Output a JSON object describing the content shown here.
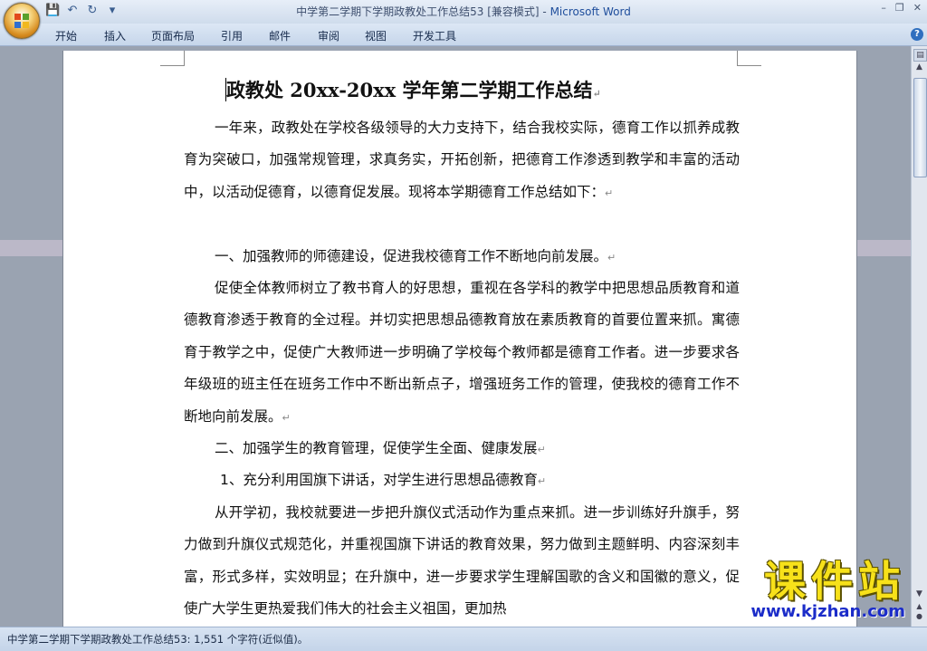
{
  "window": {
    "title_doc": "中学第二学期下学期政教处工作总结53 [兼容模式]",
    "title_sep": " - ",
    "title_app": "Microsoft Word",
    "min": "–",
    "restore": "❐",
    "close": "✕"
  },
  "qat": {
    "save_icon": "floppy-disk-icon",
    "undo_icon": "undo-icon",
    "redo_icon": "redo-icon",
    "customize_icon": "dropdown-icon"
  },
  "ribbon_tabs": [
    "开始",
    "插入",
    "页面布局",
    "引用",
    "邮件",
    "审阅",
    "视图",
    "开发工具"
  ],
  "document": {
    "title": "政教处 20xx-20xx 学年第二学期工作总结",
    "paragraphs": [
      "一年来，政教处在学校各级领导的大力支持下，结合我校实际，德育工作以抓养成教育为突破口，加强常规管理，求真务实，开拓创新，把德育工作渗透到教学和丰富的活动中，以活动促德育，以德育促发展。现将本学期德育工作总结如下：",
      "一、加强教师的师德建设，促进我校德育工作不断地向前发展。",
      "促使全体教师树立了教书育人的好思想，重视在各学科的教学中把思想品质教育和道德教育渗透于教育的全过程。并切实把思想品德教育放在素质教育的首要位置来抓。寓德育于教学之中，促使广大教师进一步明确了学校每个教师都是德育工作者。进一步要求各年级班的班主任在班务工作中不断出新点子，增强班务工作的管理，使我校的德育工作不断地向前发展。",
      "二、加强学生的教育管理，促使学生全面、健康发展",
      "1、充分利用国旗下讲话，对学生进行思想品德教育",
      "从开学初，我校就要进一步把升旗仪式活动作为重点来抓。进一步训练好升旗手，努力做到升旗仪式规范化，并重视国旗下讲话的教育效果，努力做到主题鲜明、内容深刻丰富，形式多样，实效明显；在升旗中，进一步要求学生理解国歌的含义和国徽的意义，促使广大学生更热爱我们伟大的社会主义祖国，更加热"
    ],
    "paragraph_mark": "↵"
  },
  "statusbar": {
    "text": "中学第二学期下学期政教处工作总结53: 1,551 个字符(近似值)。"
  },
  "watermark": {
    "big": "课件站",
    "small": "www.kjzhan.com"
  }
}
